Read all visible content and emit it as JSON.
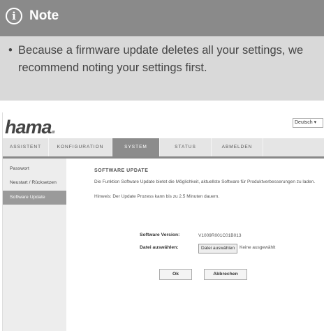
{
  "note": {
    "icon": "info-icon",
    "icon_glyph": "i",
    "title": "Note",
    "bullet": "•",
    "text": "Because a firmware update deletes all your settings, we recommend noting your settings first."
  },
  "router_ui": {
    "logo": {
      "text": "hama",
      "dot": "."
    },
    "language": "Deutsch ▾",
    "nav": [
      {
        "label": "ASSISTENT",
        "active": false
      },
      {
        "label": "KONFIGURATION",
        "active": false
      },
      {
        "label": "SYSTEM",
        "active": true
      },
      {
        "label": "STATUS",
        "active": false
      },
      {
        "label": "ABMELDEN",
        "active": false
      }
    ],
    "sidebar": [
      {
        "label": "Passwort",
        "active": false
      },
      {
        "label": "Neustart / Rücksetzen",
        "active": false
      },
      {
        "label": "Software Update",
        "active": true
      }
    ],
    "content": {
      "title": "SOFTWARE UPDATE",
      "description": "Die Funktion Software Update bietet die Möglichkeit, aktuellste Software für Produktverbesserungen zu laden.",
      "hint": "Hinweis: Der Update Prozess kann bis zu 2.5 Minuten dauern.",
      "version_label": "Software Version:",
      "version_value": "V1009R001C01B013",
      "file_label": "Datei auswählen:",
      "file_button": "Datei auswählen",
      "file_status": "Keine ausgewählt",
      "ok_button": "Ok",
      "cancel_button": "Abbrechen"
    }
  }
}
